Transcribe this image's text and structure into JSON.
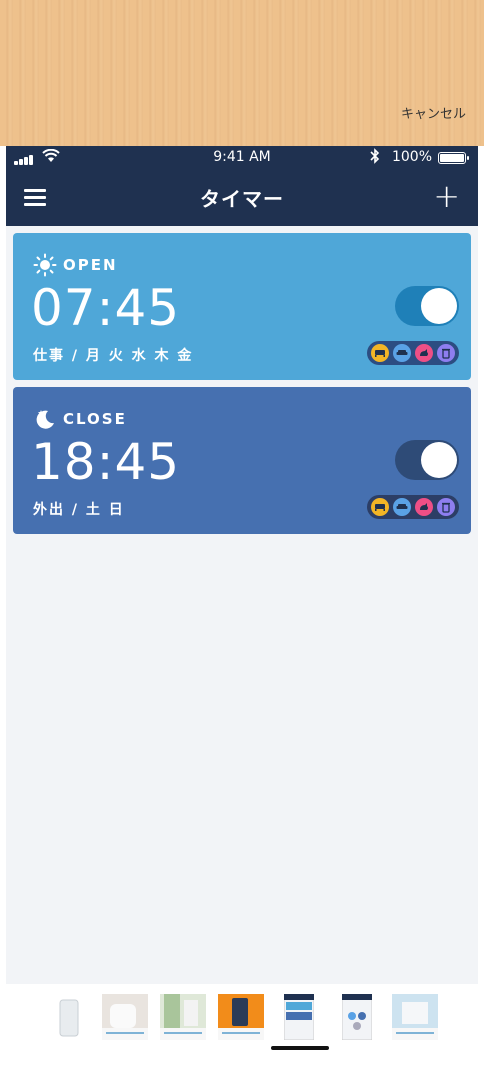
{
  "banner": {
    "cancel_label": "キャンセル"
  },
  "status_bar": {
    "time": "9:41 AM",
    "battery": "100%"
  },
  "nav": {
    "title": "タイマー",
    "menu_icon": "hamburger-menu-icon",
    "add_icon": "plus-icon"
  },
  "timers": [
    {
      "mode": "OPEN",
      "mode_icon": "sun-icon",
      "time": "07:45",
      "label": "仕事 / 月 火 水 木 金",
      "enabled": true,
      "devices": [
        "bed-icon",
        "sofa-icon",
        "pet-icon",
        "bin-icon"
      ]
    },
    {
      "mode": "CLOSE",
      "mode_icon": "moon-icon",
      "time": "18:45",
      "label": "外出 / 土 日",
      "enabled": true,
      "devices": [
        "bed-icon",
        "sofa-icon",
        "pet-icon",
        "bin-icon"
      ]
    }
  ],
  "colors": {
    "nav_bg": "#1f3150",
    "open_card": "#4fa7d8",
    "close_card": "#4670b0",
    "banner": "#eec18c"
  }
}
